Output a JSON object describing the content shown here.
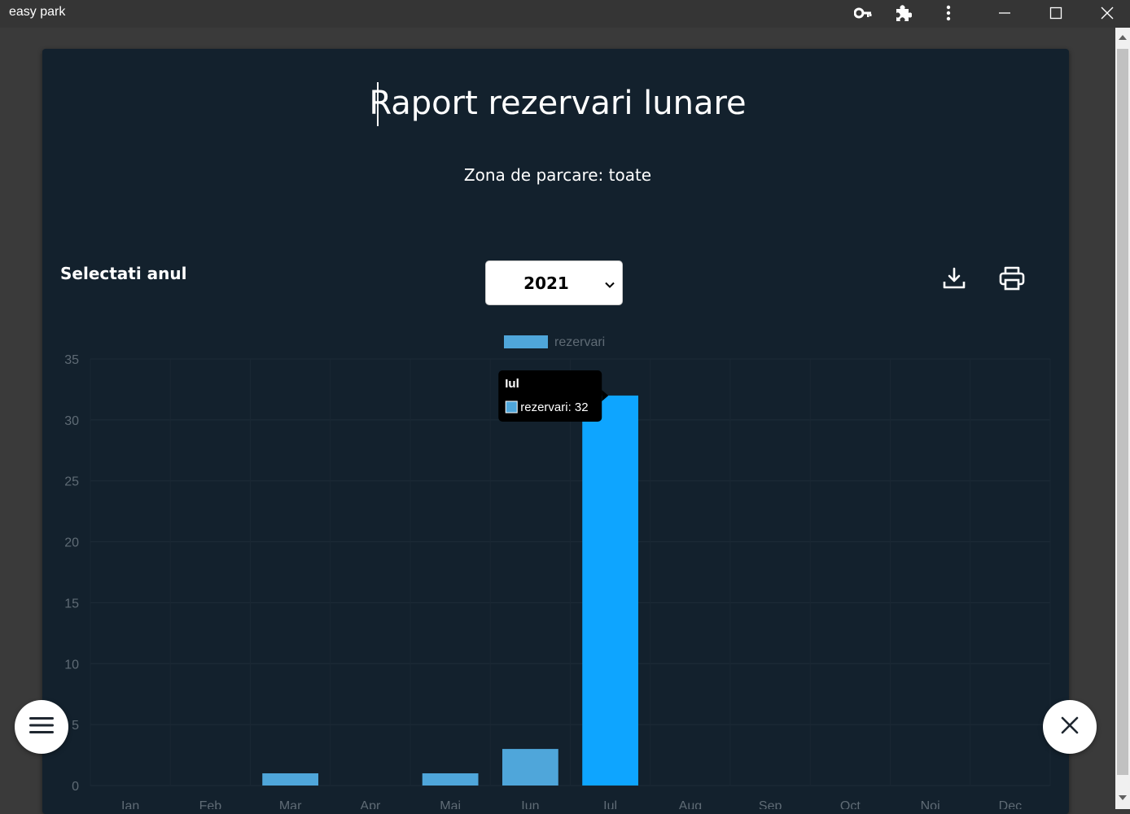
{
  "window": {
    "title": "easy park"
  },
  "page": {
    "title": "Raport rezervari lunare",
    "subtitle": "Zona de parcare: toate",
    "year_label": "Selectati anul",
    "year_selected": "2021"
  },
  "icons": {
    "key": "key-icon",
    "extensions": "puzzle-icon",
    "menu": "more-vertical-icon",
    "download": "download-icon",
    "print": "printer-icon",
    "hamburger": "hamburger-icon",
    "close": "close-icon"
  },
  "colors": {
    "card_bg": "#13212d",
    "bar": "#4fa6da",
    "bar_active": "#0ea5ff"
  },
  "chart_data": {
    "type": "bar",
    "categories": [
      "Ian",
      "Feb",
      "Mar",
      "Apr",
      "Mai",
      "Iun",
      "Iul",
      "Aug",
      "Sep",
      "Oct",
      "Noi",
      "Dec"
    ],
    "series": [
      {
        "name": "rezervari",
        "values": [
          0,
          0,
          1,
          0,
          1,
          3,
          32,
          0,
          0,
          0,
          0,
          0
        ]
      }
    ],
    "ylim": [
      0,
      35
    ],
    "yticks": [
      0,
      5,
      10,
      15,
      20,
      25,
      30,
      35
    ],
    "grid": true,
    "legend": "top",
    "tooltip": {
      "title": "Iul",
      "label": "rezervari: 32"
    }
  }
}
